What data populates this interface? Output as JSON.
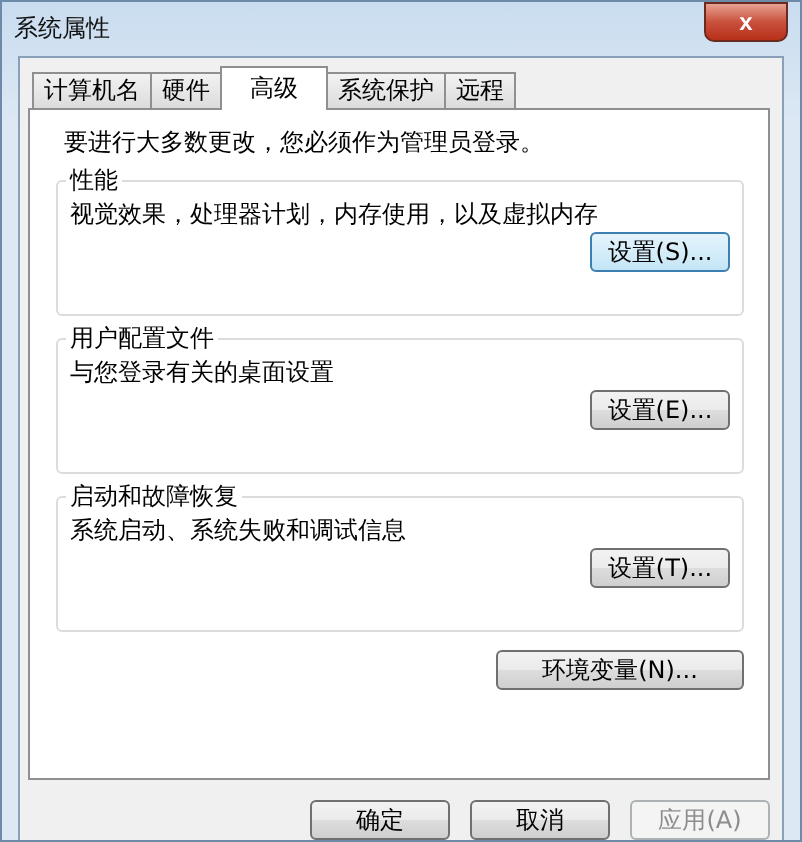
{
  "window": {
    "title": "系统属性",
    "close": "x"
  },
  "tabs": [
    {
      "label": "计算机名",
      "selected": false
    },
    {
      "label": "硬件",
      "selected": false
    },
    {
      "label": "高级",
      "selected": true
    },
    {
      "label": "系统保护",
      "selected": false
    },
    {
      "label": "远程",
      "selected": false
    }
  ],
  "notice": "要进行大多数更改，您必须作为管理员登录。",
  "groups": [
    {
      "title": "性能",
      "description": "视觉效果，处理器计划，内存使用，以及虚拟内存",
      "button": "设置(S)...",
      "focused": true
    },
    {
      "title": "用户配置文件",
      "description": "与您登录有关的桌面设置",
      "button": "设置(E)...",
      "focused": false
    },
    {
      "title": "启动和故障恢复",
      "description": "系统启动、系统失败和调试信息",
      "button": "设置(T)...",
      "focused": false
    }
  ],
  "env_button": "环境变量(N)...",
  "buttons": [
    {
      "label": "确定",
      "disabled": false
    },
    {
      "label": "取消",
      "disabled": false
    },
    {
      "label": "应用(A)",
      "disabled": true
    }
  ]
}
